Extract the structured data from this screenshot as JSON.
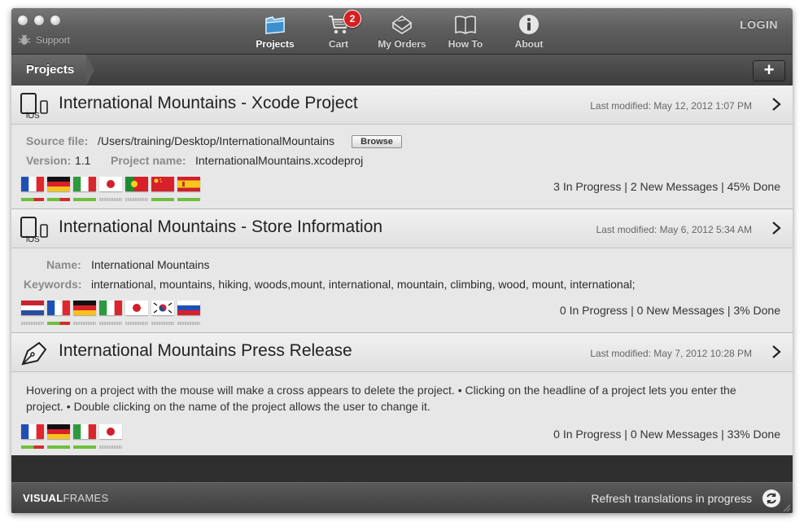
{
  "toolbar": {
    "support_label": "Support",
    "items": [
      {
        "label": "Projects",
        "icon": "folder-icon"
      },
      {
        "label": "Cart",
        "icon": "cart-icon",
        "badge": "2"
      },
      {
        "label": "My Orders",
        "icon": "orders-icon"
      },
      {
        "label": "How To",
        "icon": "book-icon"
      },
      {
        "label": "About",
        "icon": "info-icon"
      }
    ],
    "login_label": "LOGIN"
  },
  "breadcrumb": {
    "label": "Projects",
    "add_label": "+"
  },
  "projects": [
    {
      "title": "International Mountains  - Xcode Project",
      "icon_label": "iOS",
      "last_modified": "Last modified: May 12, 2012 1:07 PM",
      "source_label": "Source file:",
      "source_value": "/Users/training/Desktop/InternationalMountains",
      "browse_label": "Browse",
      "version_label": "Version:",
      "version_value": "1.1",
      "pname_label": "Project name:",
      "pname_value": "InternationalMountains.xcodeproj",
      "progress": "3 In Progress | 2 New Messages | 45% Done",
      "flags": [
        {
          "name": "france",
          "status": "mixed"
        },
        {
          "name": "germany",
          "status": "mixed"
        },
        {
          "name": "italy",
          "status": "done"
        },
        {
          "name": "japan",
          "status": "pending"
        },
        {
          "name": "portugal",
          "status": "pending"
        },
        {
          "name": "china",
          "status": "done"
        },
        {
          "name": "spain",
          "status": "done"
        }
      ]
    },
    {
      "title": "International Mountains  - Store Information",
      "icon_label": "iOS",
      "last_modified": "Last modified: May 6, 2012 5:34 AM",
      "name_label": "Name:",
      "name_value": "International Mountains",
      "keywords_label": "Keywords:",
      "keywords_value": "international, mountains, hiking, woods,mount, international, mountain, climbing, wood, mount, international;",
      "progress": "0 In Progress | 0 New Messages | 3% Done",
      "flags": [
        {
          "name": "netherlands",
          "status": "pending"
        },
        {
          "name": "france",
          "status": "mixed"
        },
        {
          "name": "germany",
          "status": "pending"
        },
        {
          "name": "italy",
          "status": "pending"
        },
        {
          "name": "japan",
          "status": "pending"
        },
        {
          "name": "korea",
          "status": "pending"
        },
        {
          "name": "russia",
          "status": "pending"
        }
      ]
    },
    {
      "title": "International Mountains Press Release",
      "last_modified": "Last modified: May 7, 2012 10:28 PM",
      "description": "Hovering on a project with the mouse will make a cross appears to delete the project. • Clicking on the headline of a project lets you enter the project. • Double clicking on the name of the project allows the user to change it.",
      "progress": "0 In Progress | 0 New Messages | 33% Done",
      "flags": [
        {
          "name": "france",
          "status": "mixed"
        },
        {
          "name": "germany",
          "status": "done"
        },
        {
          "name": "italy",
          "status": "done"
        },
        {
          "name": "japan",
          "status": "pending"
        }
      ]
    }
  ],
  "footer": {
    "brand_bold": "VISUAL",
    "brand_light": "FRAMES",
    "status": "Refresh translations in progress"
  },
  "colors": {
    "done": "#6fbf3d",
    "mixed_red": "#d42b2b",
    "pending": "#c9c9c9"
  }
}
